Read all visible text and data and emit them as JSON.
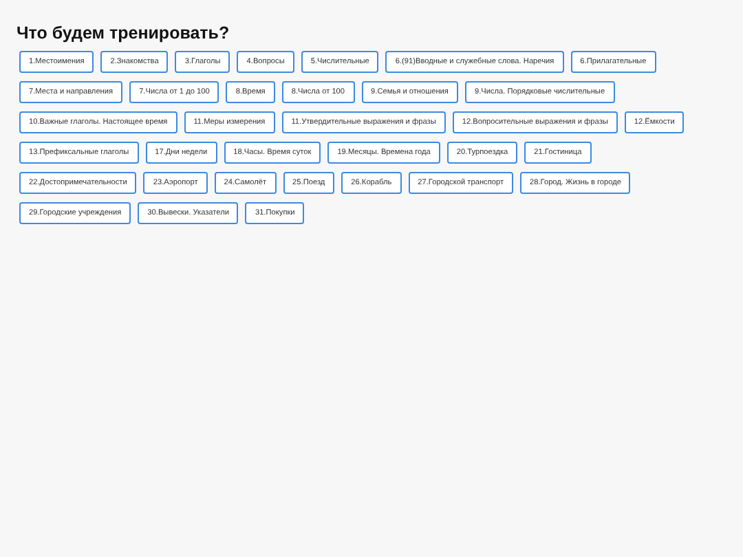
{
  "title": "Что будем тренировать?",
  "topics": [
    "1.Местоимения",
    "2.Знакомства",
    "3.Глаголы",
    "4.Вопросы",
    "5.Числительные",
    "6.(91)Вводные и служебные слова. Наречия",
    "6.Прилагательные",
    "7.Места и направления",
    "7.Числа от 1 до 100",
    "8.Время",
    "8.Числа от 100",
    "9.Семья и отношения",
    "9.Числа. Порядковые числительные",
    "10.Важные глаголы. Настоящее время",
    "11.Меры измерения",
    "11.Утвердительные выражения и фразы",
    "12.Вопросительные выражения и фразы",
    "12.Ёмкости",
    "13.Префиксальные глаголы",
    "17.Дни недели",
    "18.Часы. Время суток",
    "19.Месяцы. Времена года",
    "20.Турпоездка",
    "21.Гостиница",
    "22.Достопримечательности",
    "23.Аэропорт",
    "24.Самолёт",
    "25.Поезд",
    "26.Корабль",
    "27.Городской транспорт",
    "28.Город. Жизнь в городе",
    "29.Городские учреждения",
    "30.Вывески. Указатели",
    "31.Покупки"
  ]
}
